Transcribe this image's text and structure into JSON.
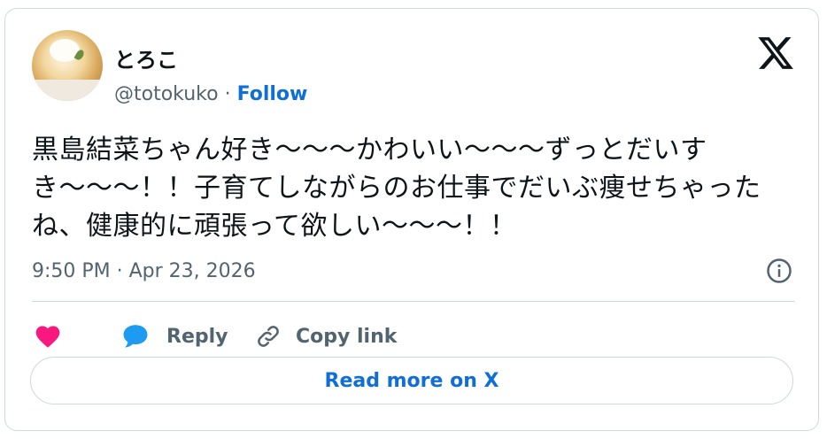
{
  "user": {
    "display_name": "とろこ",
    "handle": "@totokuko",
    "separator": " · ",
    "follow_label": "Follow"
  },
  "tweet": {
    "text": "黒島結菜ちゃん好き〜〜〜かわいい〜〜〜ずっとだいすき〜〜〜！！子育てしながらのお仕事でだいぶ痩せちゃったね、健康的に頑張って欲しい〜〜〜！！",
    "timestamp": "9:50 PM · Apr 23, 2026"
  },
  "actions": {
    "reply_label": "Reply",
    "copy_link_label": "Copy link",
    "read_more_label": "Read more on X"
  },
  "icons": {
    "x_logo": "x-logo-icon",
    "info": "info-icon",
    "like": "heart-icon",
    "reply": "speech-bubble-icon",
    "copy": "link-icon"
  },
  "colors": {
    "accent": "#0f6fd6",
    "like": "#f91880",
    "reply_icon": "#1d9bf0",
    "secondary_text": "#536471",
    "border": "#cfd9de"
  }
}
